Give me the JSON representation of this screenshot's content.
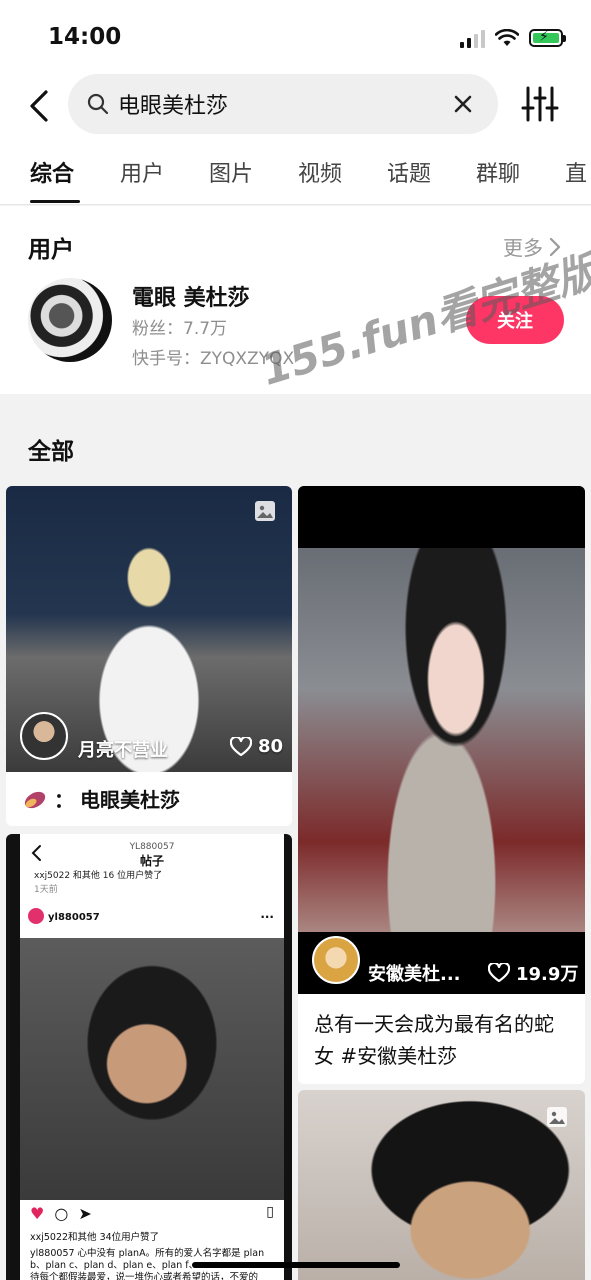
{
  "status_bar": {
    "time": "14:00"
  },
  "search": {
    "query": "电眼美杜莎"
  },
  "tabs": [
    {
      "label": "综合",
      "active": true
    },
    {
      "label": "用户"
    },
    {
      "label": "图片"
    },
    {
      "label": "视频"
    },
    {
      "label": "话题"
    },
    {
      "label": "群聊"
    },
    {
      "label": "直"
    }
  ],
  "user_section": {
    "title": "用户",
    "more_label": "更多",
    "user": {
      "name": "電眼 美杜莎",
      "fans": "粉丝：7.7万",
      "kuaishou_id": "快手号：ZYQXZYQX",
      "follow_label": "关注"
    }
  },
  "watermark": "155.fun看完整版",
  "all_section": {
    "title": "全部"
  },
  "cards": [
    {
      "author": "月亮不营业",
      "likes": "80",
      "caption_prefix": "：",
      "caption": "电眼美杜莎"
    },
    {
      "author": "安徽美杜...",
      "likes": "19.9万",
      "caption": "总有一天会成为最有名的蛇女 #安徽美杜莎"
    },
    {
      "screenshot": {
        "header_id": "YL880057",
        "header_title": "帖子",
        "top_line": "xxj5022 和其他 16 位用户赞了",
        "time_ago": "1天前",
        "username": "yl880057",
        "likes_line": "xxj5022和其他 34位用户赞了",
        "body_line1": "yl880057 心中没有 planA。所有的爱人名字都是 plan",
        "body_line2": "b、plan c、plan d、plan e、plan f、...",
        "body_line3": "待每个都假装最爱，说一堆伤心或者希望的话，不爱的"
      }
    },
    {}
  ],
  "colors": {
    "accent": "#fe3666",
    "battery": "#34c759"
  }
}
